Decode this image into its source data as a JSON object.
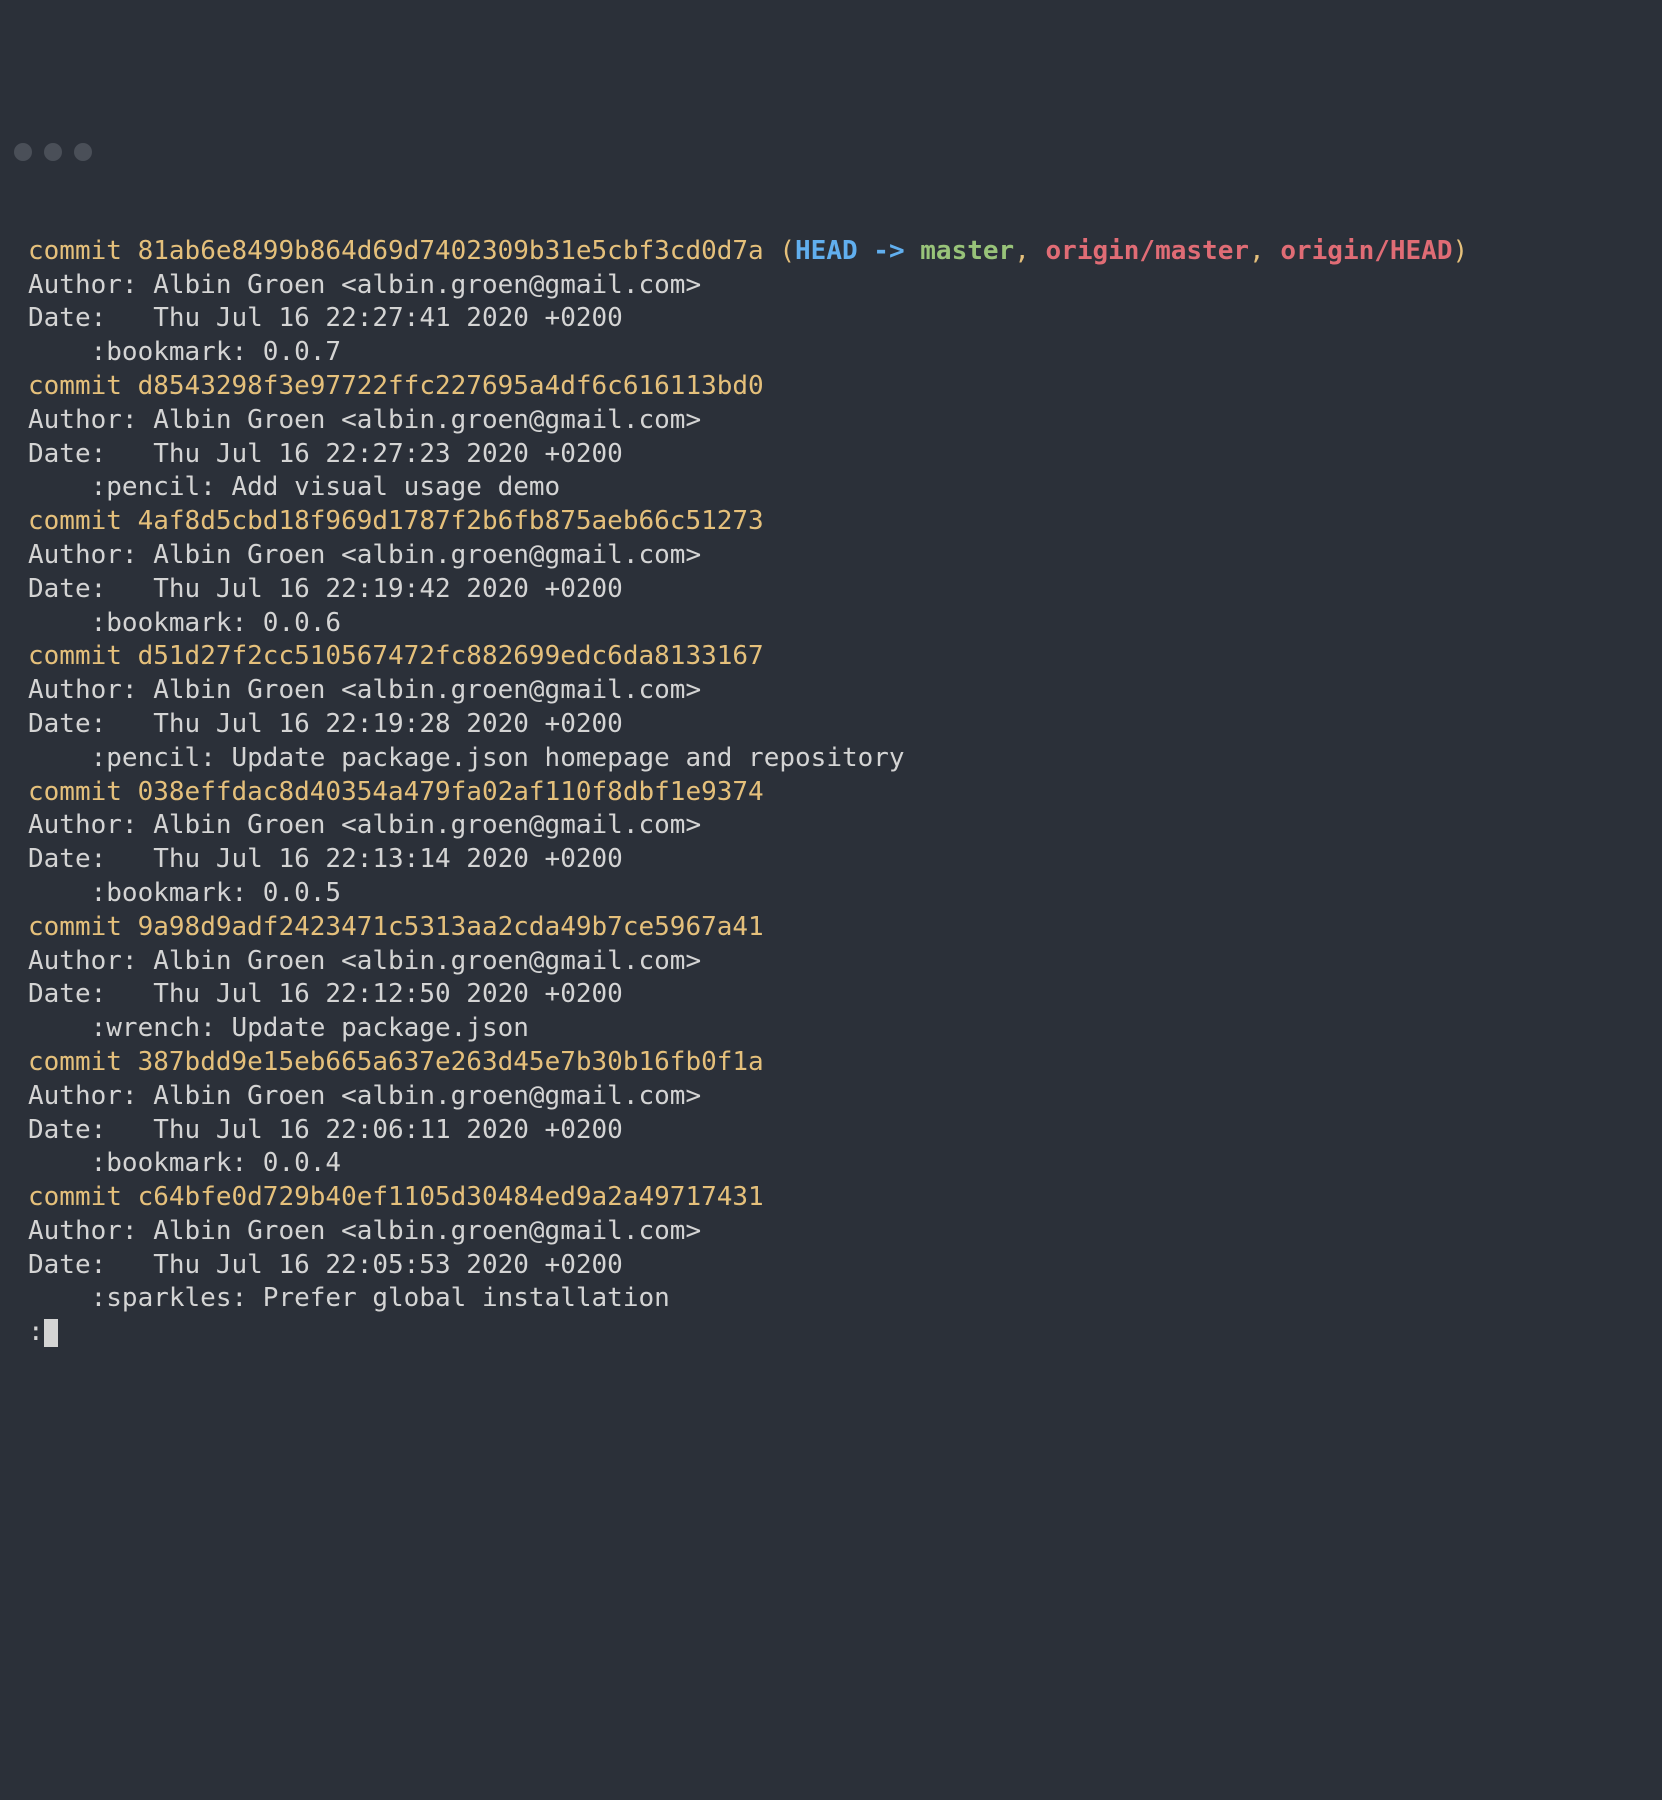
{
  "commits": [
    {
      "commit_word": "commit",
      "hash": "81ab6e8499b864d69d7402309b31e5cbf3cd0d7a",
      "refs": {
        "open": " (",
        "head": "HEAD",
        "arrow": " -> ",
        "branch": "master",
        "comma1": ", ",
        "remote1": "origin/master",
        "comma2": ", ",
        "remote2": "origin/HEAD",
        "close": ")"
      },
      "author": "Author: Albin Groen <albin.groen@gmail.com>",
      "date": "Date:   Thu Jul 16 22:27:41 2020 +0200",
      "message": "    :bookmark: 0.0.7"
    },
    {
      "commit_word": "commit",
      "hash": "d8543298f3e97722ffc227695a4df6c616113bd0",
      "author": "Author: Albin Groen <albin.groen@gmail.com>",
      "date": "Date:   Thu Jul 16 22:27:23 2020 +0200",
      "message": "    :pencil: Add visual usage demo"
    },
    {
      "commit_word": "commit",
      "hash": "4af8d5cbd18f969d1787f2b6fb875aeb66c51273",
      "author": "Author: Albin Groen <albin.groen@gmail.com>",
      "date": "Date:   Thu Jul 16 22:19:42 2020 +0200",
      "message": "    :bookmark: 0.0.6"
    },
    {
      "commit_word": "commit",
      "hash": "d51d27f2cc510567472fc882699edc6da8133167",
      "author": "Author: Albin Groen <albin.groen@gmail.com>",
      "date": "Date:   Thu Jul 16 22:19:28 2020 +0200",
      "message": "    :pencil: Update package.json homepage and repository"
    },
    {
      "commit_word": "commit",
      "hash": "038effdac8d40354a479fa02af110f8dbf1e9374",
      "author": "Author: Albin Groen <albin.groen@gmail.com>",
      "date": "Date:   Thu Jul 16 22:13:14 2020 +0200",
      "message": "    :bookmark: 0.0.5"
    },
    {
      "commit_word": "commit",
      "hash": "9a98d9adf2423471c5313aa2cda49b7ce5967a41",
      "author": "Author: Albin Groen <albin.groen@gmail.com>",
      "date": "Date:   Thu Jul 16 22:12:50 2020 +0200",
      "message": "    :wrench: Update package.json"
    },
    {
      "commit_word": "commit",
      "hash": "387bdd9e15eb665a637e263d45e7b30b16fb0f1a",
      "author": "Author: Albin Groen <albin.groen@gmail.com>",
      "date": "Date:   Thu Jul 16 22:06:11 2020 +0200",
      "message": "    :bookmark: 0.0.4"
    },
    {
      "commit_word": "commit",
      "hash": "c64bfe0d729b40ef1105d30484ed9a2a49717431",
      "author": "Author: Albin Groen <albin.groen@gmail.com>",
      "date": "Date:   Thu Jul 16 22:05:53 2020 +0200",
      "message": "    :sparkles: Prefer global installation"
    }
  ],
  "prompt": ":"
}
